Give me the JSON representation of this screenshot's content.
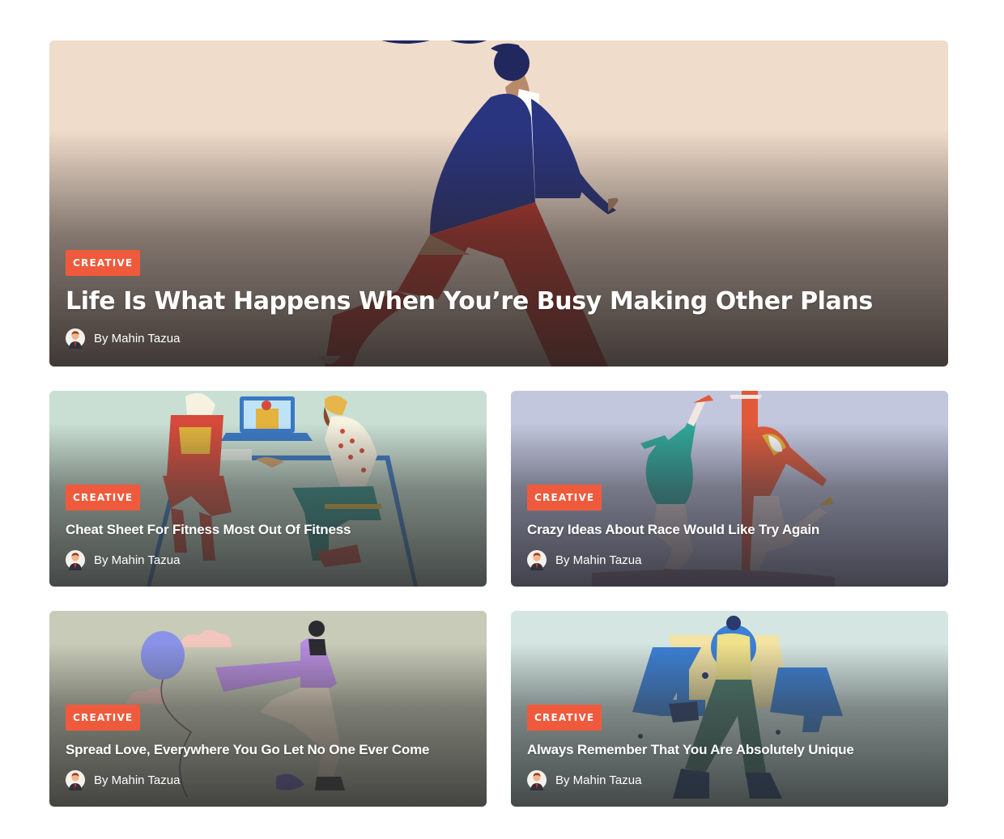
{
  "theme": {
    "badge_color": "#f05a3c"
  },
  "posts": [
    {
      "category": "CREATIVE",
      "title": "Life Is What Happens When You’re Busy Making Other Plans",
      "author": "By Mahin Tazua"
    },
    {
      "category": "CREATIVE",
      "title": "Cheat Sheet For Fitness Most Out Of Fitness",
      "author": "By Mahin Tazua"
    },
    {
      "category": "CREATIVE",
      "title": "Crazy Ideas About Race Would Like Try Again",
      "author": "By Mahin Tazua"
    },
    {
      "category": "CREATIVE",
      "title": "Spread Love, Everywhere You Go Let No One Ever Come",
      "author": "By Mahin Tazua"
    },
    {
      "category": "CREATIVE",
      "title": "Always Remember That You Are Absolutely Unique",
      "author": "By Mahin Tazua"
    }
  ]
}
